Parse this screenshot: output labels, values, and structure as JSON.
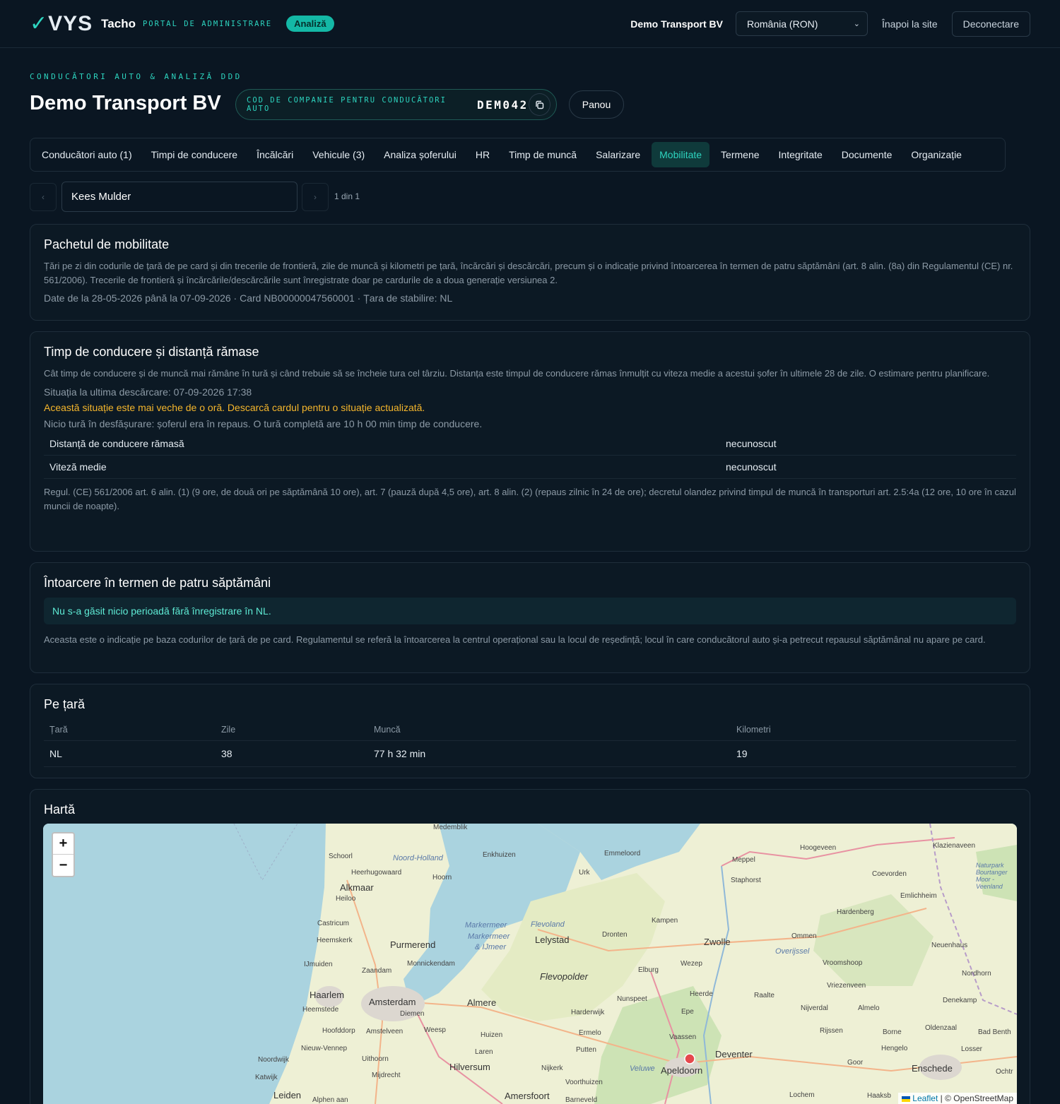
{
  "topbar": {
    "logo": "VYS",
    "product": "Tacho",
    "subtitle": "PORTAL DE ADMINISTRARE",
    "badge": "Analiză",
    "company": "Demo Transport BV",
    "region_select": "România (RON)",
    "back_link": "Înapoi la site",
    "logout": "Deconectare"
  },
  "header": {
    "eyebrow": "CONDUCĂTORI AUTO & ANALIZĂ DDD",
    "title": "Demo Transport BV",
    "code_label": "COD DE COMPANIE PENTRU CONDUCĂTORI AUTO",
    "code_value": "DEM042",
    "panou": "Panou"
  },
  "tabs": [
    {
      "label": "Conducători auto (1)"
    },
    {
      "label": "Timpi de conducere"
    },
    {
      "label": "Încălcări"
    },
    {
      "label": "Vehicule (3)"
    },
    {
      "label": "Analiza șoferului"
    },
    {
      "label": "HR"
    },
    {
      "label": "Timp de muncă"
    },
    {
      "label": "Salarizare"
    },
    {
      "label": "Mobilitate",
      "active": true
    },
    {
      "label": "Termene"
    },
    {
      "label": "Integritate"
    },
    {
      "label": "Documente"
    },
    {
      "label": "Organizație"
    }
  ],
  "pager": {
    "prev": "‹",
    "next": "›",
    "driver": "Kees Mulder",
    "count": "1 din 1"
  },
  "mobility": {
    "title": "Pachetul de mobilitate",
    "description": "Țări pe zi din codurile de țară de pe card și din trecerile de frontieră, zile de muncă și kilometri pe țară, încărcări și descărcări, precum și o indicație privind întoarcerea în termen de patru săptămâni (art. 8 alin. (8a) din Regulamentul (CE) nr. 561/2006). Trecerile de frontieră și încărcările/descărcările sunt înregistrate doar pe cardurile de a doua generație versiunea 2.",
    "meta": "Date de la 28-05-2026 până la 07-09-2026 · Card NB00000047560001 · Țara de stabilire: NL"
  },
  "remaining": {
    "title": "Timp de conducere și distanță rămase",
    "description": "Cât timp de conducere și de muncă mai rămâne în tură și când trebuie să se încheie tura cel târziu. Distanța este timpul de conducere rămas înmulțit cu viteza medie a acestui șofer în ultimele 28 de zile. O estimare pentru planificare.",
    "status": "Situația la ultima descărcare: 07-09-2026 17:38",
    "warning": "Această situație este mai veche de o oră. Descarcă cardul pentru o situație actualizată.",
    "no_shift": "Nicio tură în desfășurare: șoferul era în repaus. O tură completă are 10 h 00 min timp de conducere.",
    "rows": [
      {
        "label": "Distanță de conducere rămasă",
        "value": "necunoscut"
      },
      {
        "label": "Viteză medie",
        "value": "necunoscut"
      }
    ],
    "legal": "Regul. (CE) 561/2006 art. 6 alin. (1) (9 ore, de două ori pe săptămână 10 ore), art. 7 (pauză după 4,5 ore), art. 8 alin. (2) (repaus zilnic în 24 de ore); decretul olandez privind timpul de muncă în transporturi art. 2.5:4a (12 ore, 10 ore în cazul muncii de noapte)."
  },
  "return": {
    "title": "Întoarcere în termen de patru săptămâni",
    "info": "Nu s-a găsit nicio perioadă fără înregistrare în NL.",
    "note": "Aceasta este o indicație pe baza codurilor de țară de pe card. Regulamentul se referă la întoarcerea la centrul operațional sau la locul de reședință; locul în care conducătorul auto și-a petrecut repausul săptămânal nu apare pe card."
  },
  "countries": {
    "title": "Pe țară",
    "headers": [
      "Țară",
      "Zile",
      "Muncă",
      "Kilometri"
    ],
    "rows": [
      {
        "country": "NL",
        "days": "38",
        "work": "77 h 32 min",
        "km": "19"
      }
    ]
  },
  "map": {
    "title": "Hartă",
    "zoom_in": "+",
    "zoom_out": "−",
    "attribution_leaflet": "Leaflet",
    "attribution_osm": "| © OpenStreetMap",
    "labels": {
      "medemblik": "Medemblik",
      "schoorl": "Schoorl",
      "noord_holland": "Noord-Holland",
      "enkhuizen": "Enkhuizen",
      "heerhugowaard": "Heerhugowaard",
      "hoorn": "Hoorn",
      "alkmaar": "Alkmaar",
      "heiloo": "Heiloo",
      "castricum": "Castricum",
      "heemskerk": "Heemskerk",
      "purmerend": "Purmerend",
      "ijmuiden": "IJmuiden",
      "zaandam": "Zaandam",
      "monnickendam": "Monnickendam",
      "haarlem": "Haarlem",
      "amsterdam": "Amsterdam",
      "heemstede": "Heemstede",
      "diemen": "Diemen",
      "almere": "Almere",
      "hoofddorp": "Hoofddorp",
      "amstelveen": "Amstelveen",
      "weesp": "Weesp",
      "huizen": "Huizen",
      "nieuw_vennep": "Nieuw-Vennep",
      "laren": "Laren",
      "noordwijk": "Noordwijk",
      "uithoorn": "Uithoorn",
      "hilversum": "Hilversum",
      "katwijk": "Katwijk",
      "mijdrecht": "Mijdrecht",
      "leiden": "Leiden",
      "alphen": "Alphen aan",
      "amersfoort": "Amersfoort",
      "urk": "Urk",
      "emmeloord": "Emmeloord",
      "markermeer1": "Markermeer",
      "markermeer2": "Markermeer",
      "ijmeer": "& IJmeer",
      "flevoland": "Flevoland",
      "lelystad": "Lelystad",
      "flevopolder": "Flevopolder",
      "dronten": "Dronten",
      "kampen": "Kampen",
      "zwolle": "Zwolle",
      "meppel": "Meppel",
      "staphorst": "Staphorst",
      "hoogeveen": "Hoogeveen",
      "coevorden": "Coevorden",
      "klazienaveen": "Klazienaveen",
      "emlichheim": "Emlichheim",
      "hardenberg": "Hardenberg",
      "ommen": "Ommen",
      "overijssel": "Overijssel",
      "neuenhaus": "Neuenhaus",
      "vroomshoop": "Vroomshoop",
      "wezep": "Wezep",
      "elburg": "Elburg",
      "nordhorn": "Nordhorn",
      "vriezenveen": "Vriezenveen",
      "heerde": "Heerde",
      "nunspeet": "Nunspeet",
      "raalte": "Raalte",
      "denekamp": "Denekamp",
      "harderwijk": "Harderwijk",
      "epe": "Epe",
      "nijverdal": "Nijverdal",
      "almelo": "Almelo",
      "ermelo": "Ermelo",
      "vaassen": "Vaassen",
      "rijssen": "Rijssen",
      "borne": "Borne",
      "oldenzaal": "Oldenzaal",
      "bad_bentheim": "Bad Benth",
      "putten": "Putten",
      "deventer": "Deventer",
      "hengelo": "Hengelo",
      "losser": "Losser",
      "nijkerk": "Nijkerk",
      "veluwe": "Veluwe",
      "apeldoorn": "Apeldoorn",
      "goor": "Goor",
      "enschede": "Enschede",
      "voorthuizen": "Voorthuizen",
      "lochem": "Lochem",
      "haaksb": "Haaksb",
      "ochtr": "Ochtr",
      "barneveld": "Barneveld",
      "naturpark": "Naturpark Bourtanger Moor - Veenland"
    },
    "marker_city": "Apeldoorn"
  }
}
